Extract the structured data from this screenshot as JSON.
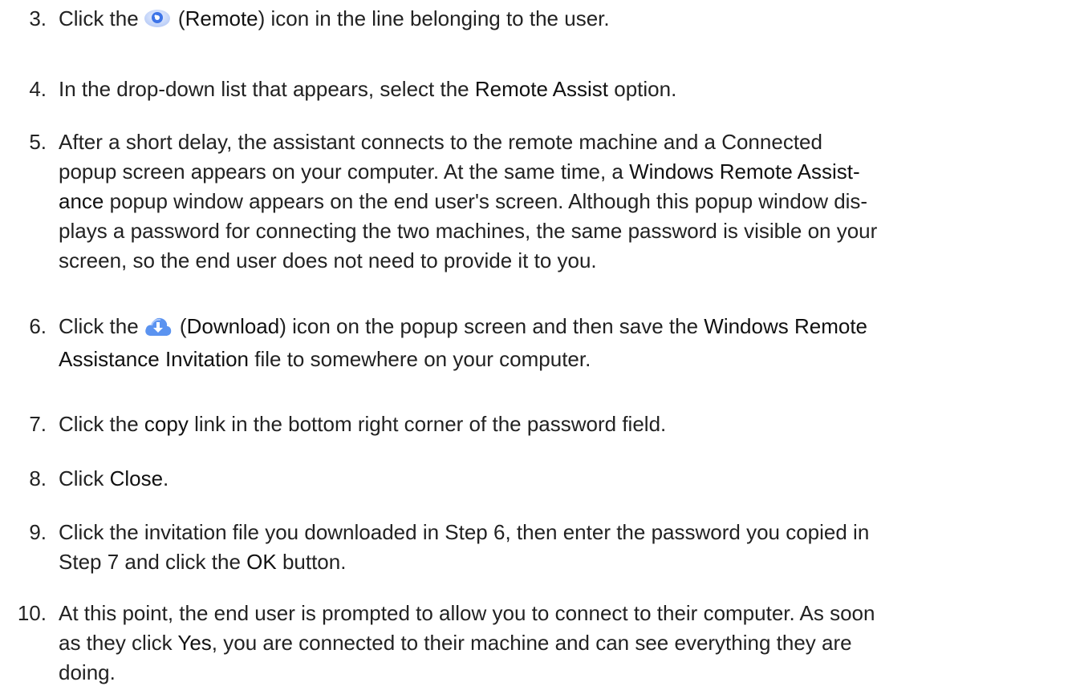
{
  "icons": {
    "remote": "remote-eye-icon",
    "download": "cloud-download-icon"
  },
  "colors": {
    "text": "#222222",
    "icon_blue": "#3d74e8",
    "icon_light": "#c9d8fb"
  },
  "steps": [
    {
      "number": "3.",
      "lines": [
        {
          "a": "Click the",
          "b": " (",
          "c": "Remote",
          "d": ") icon in the line belonging to the user."
        }
      ]
    },
    {
      "number": "4.",
      "lines": [
        {
          "a": "In the drop-down list that appears, select the ",
          "b": "Remote Assist",
          "c": " option."
        }
      ]
    },
    {
      "number": "5.",
      "lines": [
        {
          "a": "After a short delay, the assistant connects to the remote machine and a Connected"
        },
        {
          "a": "popup screen appears on your computer. At the same time, a ",
          "b": "Windows Remote Assist-"
        },
        {
          "a": "ance",
          "b": " popup window appears on the end user's screen. Although this popup window dis-"
        },
        {
          "a": "plays a password for connecting the two machines, the same password is visible on your"
        },
        {
          "a": "screen, so the end user does not need to provide it to you."
        }
      ]
    },
    {
      "number": "6.",
      "lines": [
        {
          "a": "Click the",
          "b": " (",
          "c": "Download",
          "d": ") icon on the popup screen and then save the ",
          "e": "Windows Remote"
        },
        {
          "a": "Assistance Invitation",
          "b": " file to somewhere on your computer."
        }
      ]
    },
    {
      "number": "7.",
      "lines": [
        {
          "a": "Click the ",
          "b": "copy",
          "c": " link in the bottom right corner of the password field."
        }
      ]
    },
    {
      "number": "8.",
      "lines": [
        {
          "a": "Click ",
          "b": "Close",
          "c": "."
        }
      ]
    },
    {
      "number": "9.",
      "lines": [
        {
          "a": "Click the invitation file you downloaded in Step 6, then enter the password you copied in"
        },
        {
          "a": "Step 7 and click the ",
          "b": "OK",
          "c": " button."
        }
      ]
    },
    {
      "number": "10.",
      "lines": [
        {
          "a": "At this point, the end user is prompted to allow you to connect to their computer. As soon"
        },
        {
          "a": "as they click ",
          "b": "Yes",
          "c": ", you are connected to their machine and can see everything they are"
        },
        {
          "a": "doing."
        }
      ]
    }
  ]
}
